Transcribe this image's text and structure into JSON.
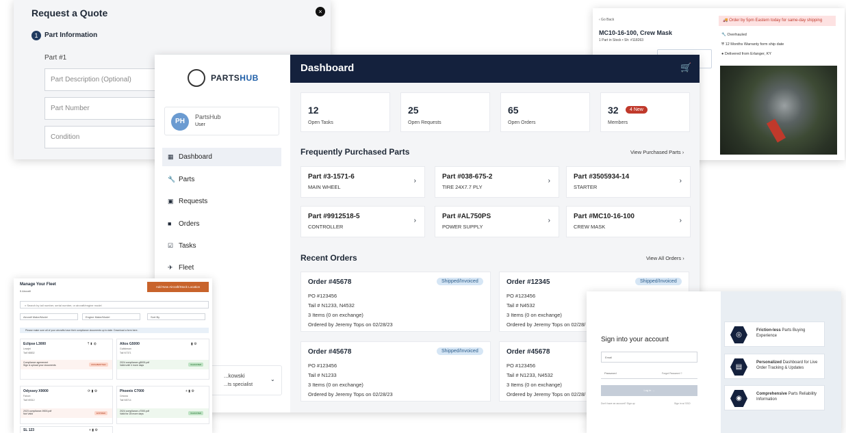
{
  "quote": {
    "title": "Request a Quote",
    "close_icon": "×",
    "step_number": "1",
    "step_label": "Part Information",
    "part_label": "Part #1",
    "fields": [
      "Part Description (Optional)",
      "Part Number",
      "Condition"
    ]
  },
  "product": {
    "back": "‹ Go Back",
    "shipping": "Order by 5pm Eastern today for same-day shipping",
    "title": "MC10-16-100, Crew Mask",
    "stock": "1 Part in Stock •  Sh: #118263",
    "features": [
      "Overhauled",
      "12 Months Warranty form ship date",
      "Delivered from Erlanger, KY"
    ]
  },
  "sidebar": {
    "logo_a": "PARTS",
    "logo_b": "HUB",
    "user_initials": "PH",
    "user_name": "PartsHub",
    "user_role": "User",
    "nav": [
      "Dashboard",
      "Parts",
      "Requests",
      "Orders",
      "Tasks",
      "Fleet"
    ],
    "specialist_name": "...kowski",
    "specialist_role": "...ts specialist"
  },
  "header": {
    "title": "Dashboard"
  },
  "stats": [
    {
      "value": "12",
      "label": "Open Tasks"
    },
    {
      "value": "25",
      "label": "Open Requests"
    },
    {
      "value": "65",
      "label": "Open Orders"
    },
    {
      "value": "32",
      "label": "Members",
      "badge": "4 New"
    }
  ],
  "frequent": {
    "title": "Frequently Purchased Parts",
    "view_all": "View Purchased Parts ›",
    "parts": [
      {
        "number": "Part #3-1571-6",
        "desc": "MAIN WHEEL"
      },
      {
        "number": "Part #038-675-2",
        "desc": "TIRE 24X7.7 PLY"
      },
      {
        "number": "Part #3505934-14",
        "desc": "STARTER"
      },
      {
        "number": "Part #9912518-5",
        "desc": "CONTROLLER"
      },
      {
        "number": "Part #AL750PS",
        "desc": "POWER SUPPLY"
      },
      {
        "number": "Part #MC10-16-100",
        "desc": "CREW MASK"
      }
    ]
  },
  "orders": {
    "title": "Recent Orders",
    "view_all": "View All Orders ›",
    "items": [
      {
        "number": "Order #45678",
        "status": "Shipped/Invoiced",
        "po": "PO #123456",
        "tail": "Tail # N1233, N4532",
        "items": "3 Items (0 on exchange)",
        "by": "Ordered by Jeremy Tops on 02/28/23"
      },
      {
        "number": "Order #12345",
        "status": "Shipped/Invoiced",
        "po": "PO #123456",
        "tail": "Tail # N4532",
        "items": "3 Items (0 on exchange)",
        "by": "Ordered by Jeremy Tops on 02/28/"
      },
      {
        "number": "Order #45678",
        "status": "Shipped/Invoiced",
        "po": "PO #123456",
        "tail": "Tail # N1233",
        "items": "3 Items (0 on exchange)",
        "by": "Ordered by Jeremy Tops on 02/28/23"
      },
      {
        "number": "Order #45678",
        "status": "",
        "po": "PO #123456",
        "tail": "Tail # N1233, N4532",
        "items": "3 Items (0 on exchange)",
        "by": "Ordered by Jeremy Tops on 02/28/"
      }
    ]
  },
  "fleet": {
    "title": "Manage Your Fleet",
    "subtitle": "5 Aircraft",
    "add_button": "Add New Aircraft/Stock Location",
    "search": "Search by tail number, serial number, or aircraft/engine model",
    "filters": [
      "Aircraft Make/Model",
      "Engine Make/Model",
      "Sort By"
    ],
    "info": "Please make sure all of your aircrafts have their compliance documents up to date. Download a form here.",
    "aircraft": [
      {
        "name": "Eclipse L3000",
        "model": "Learjet",
        "tail": "Tail N8832",
        "doc": "Compliance agreement",
        "docsub": "Sign & upload your documents",
        "tag": "UNSUBMITTED"
      },
      {
        "name": "Altos G5000",
        "model": "Gulfstream",
        "tail": "Tail N7371",
        "doc": "2024 compliance-g5000.pdf",
        "docsub": "Valid until 4 more days",
        "tag": "VALIDATED"
      },
      {
        "name": "Odyssey X9000",
        "model": "Falcon",
        "tail": "Tail N9312",
        "doc": "2023 compliance-9000.pdf",
        "docsub": "Not Valid",
        "tag": "EXPIRED"
      },
      {
        "name": "Phoenix C7000",
        "model": "Cessna",
        "tail": "Tail N5714",
        "doc": "2024 compliance-c7000.pdf",
        "docsub": "Valid for 28 more days",
        "tag": "VALIDATED"
      },
      {
        "name": "SL 123",
        "model": "",
        "tail": "",
        "doc": "",
        "docsub": "",
        "tag": ""
      }
    ]
  },
  "signin": {
    "title": "Sign into your account",
    "email": "Email",
    "password": "Password",
    "forgot": "Forgot Password",
    "login": "Log in",
    "no_account": "Don't have an account? Sign up",
    "sso": "Sign in w/ SSO",
    "features": [
      {
        "strong": "Friction-less",
        "rest": " Parts Buying Experience"
      },
      {
        "strong": "Personalized",
        "rest": " Dashboard for Live Order Tracking & Updates"
      },
      {
        "strong": "Comprehensive",
        "rest": " Parts Reliability Information"
      }
    ]
  }
}
